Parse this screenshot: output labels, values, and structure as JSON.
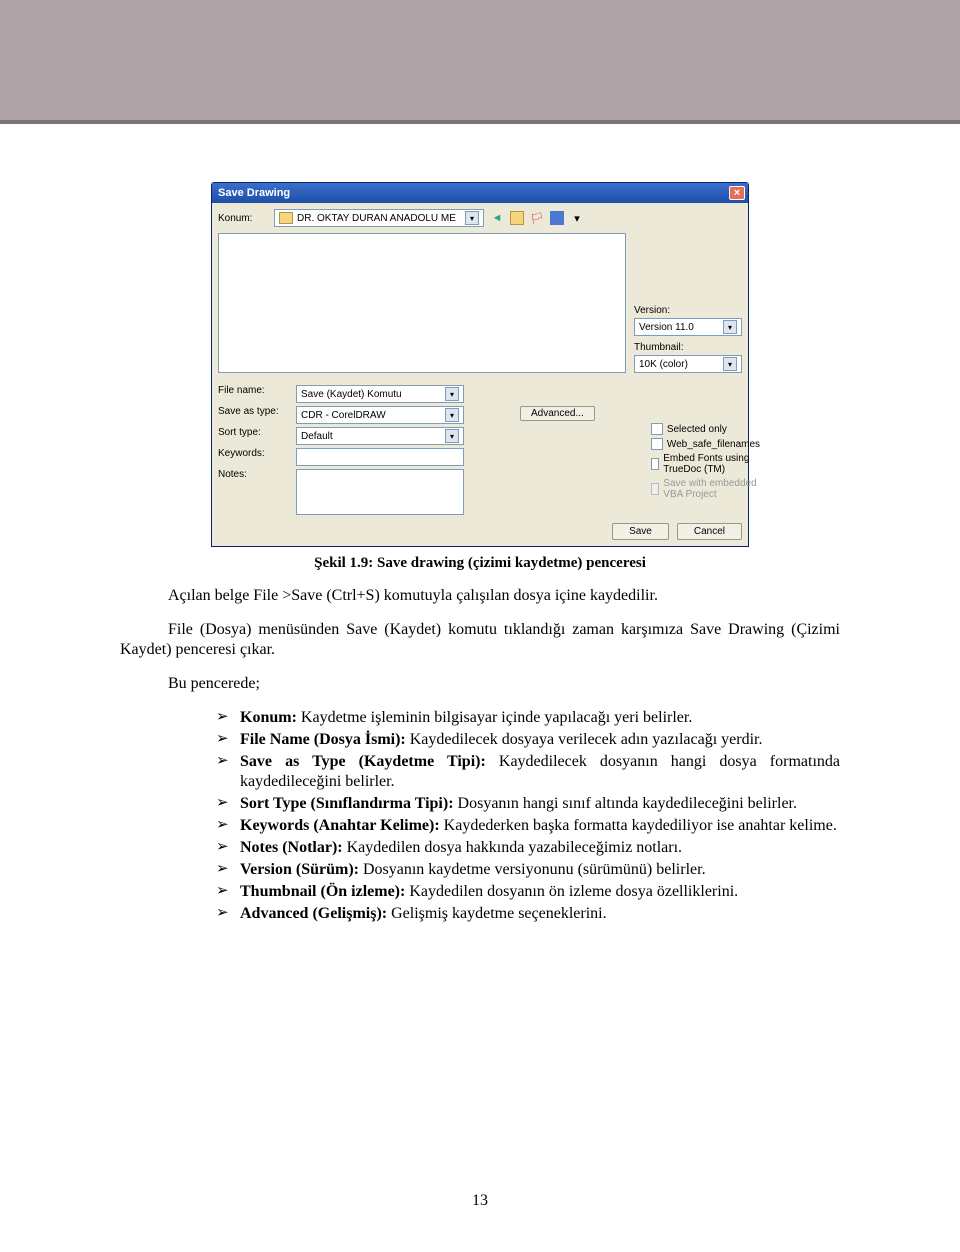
{
  "dialog": {
    "title": "Save Drawing",
    "konum_label": "Konum:",
    "konum_value": "DR. OKTAY DURAN ANADOLU ME",
    "version_label": "Version:",
    "version_value": "Version 11.0",
    "thumbnail_label": "Thumbnail:",
    "thumbnail_value": "10K (color)",
    "filename_label": "File name:",
    "filename_value": "Save (Kaydet) Komutu",
    "saveastype_label": "Save as type:",
    "saveastype_value": "CDR - CorelDRAW",
    "sorttype_label": "Sort type:",
    "sorttype_value": "Default",
    "keywords_label": "Keywords:",
    "keywords_value": "",
    "notes_label": "Notes:",
    "advanced_btn": "Advanced...",
    "cb_selected": "Selected only",
    "cb_websafe": "Web_safe_filenames",
    "cb_embed": "Embed Fonts using TrueDoc (TM)",
    "cb_vba": "Save with embedded VBA Project",
    "save_btn": "Save",
    "cancel_btn": "Cancel"
  },
  "caption": "Şekil 1.9: Save drawing (çizimi kaydetme) penceresi",
  "para1": "Açılan belge File >Save (Ctrl+S) komutuyla çalışılan dosya içine kaydedilir.",
  "para2": "File (Dosya) menüsünden Save (Kaydet) komutu tıklandığı zaman karşımıza Save Drawing (Çizimi Kaydet) penceresi çıkar.",
  "para3": "Bu pencerede;",
  "bullets": [
    {
      "b": "Konum:",
      "t": " Kaydetme işleminin bilgisayar içinde yapılacağı yeri belirler."
    },
    {
      "b": "File Name (Dosya İsmi):",
      "t": " Kaydedilecek dosyaya verilecek adın yazılacağı yerdir."
    },
    {
      "b": "Save as Type (Kaydetme Tipi):",
      "t": " Kaydedilecek dosyanın hangi dosya formatında kaydedileceğini belirler."
    },
    {
      "b": "Sort Type (Sınıflandırma Tipi):",
      "t": " Dosyanın hangi sınıf altında kaydedileceğini belirler."
    },
    {
      "b": "Keywords (Anahtar Kelime):",
      "t": " Kaydederken başka formatta kaydediliyor ise anahtar kelime."
    },
    {
      "b": "Notes (Notlar):",
      "t": " Kaydedilen dosya hakkında yazabileceğimiz notları."
    },
    {
      "b": "Version (Sürüm):",
      "t": " Dosyanın kaydetme versiyonunu (sürümünü) belirler."
    },
    {
      "b": "Thumbnail (Ön izleme):",
      "t": " Kaydedilen dosyanın ön izleme dosya özelliklerini."
    },
    {
      "b": "Advanced (Gelişmiş):",
      "t": " Gelişmiş kaydetme seçeneklerini."
    }
  ],
  "page_num": "13"
}
